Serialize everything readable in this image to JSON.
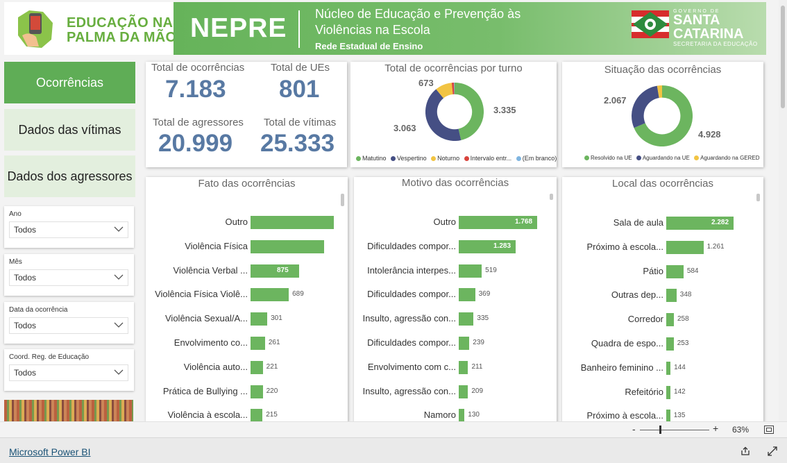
{
  "header": {
    "brand_line1": "EDUCAÇÃO NA",
    "brand_line2": "PALMA DA MÃO",
    "program": "NEPRE",
    "title_line1": "Núcleo de Educação e Prevenção às",
    "title_line2": "Violências na Escola",
    "subtitle": "Rede Estadual de Ensino",
    "gov_line": "GOVERNO DE",
    "state_line1": "SANTA",
    "state_line2": "CATARINA",
    "secretaria": "SECRETARIA DA EDUCAÇÃO"
  },
  "nav": {
    "items": [
      {
        "label": "Ocorrências",
        "active": true
      },
      {
        "label": "Dados das vítimas",
        "active": false
      },
      {
        "label": "Dados dos agressores",
        "active": false
      }
    ]
  },
  "slicers": [
    {
      "label": "Ano",
      "value": "Todos"
    },
    {
      "label": "Mês",
      "value": "Todos"
    },
    {
      "label": "Data da ocorrência",
      "value": "Todos"
    },
    {
      "label": "Coord. Reg. de Educação",
      "value": "Todos"
    }
  ],
  "kpis": {
    "ocorrencias": {
      "label": "Total de ocorrências",
      "value": "7.183"
    },
    "ues": {
      "label": "Total de UEs",
      "value": "801"
    },
    "agressores": {
      "label": "Total de agressores",
      "value": "20.999"
    },
    "vitimas": {
      "label": "Total de vítimas",
      "value": "25.333"
    }
  },
  "colors": {
    "accent": "#5fad56",
    "bar": "#6cb55f",
    "kpi": "#5879a3",
    "navy": "#454f84",
    "yellow": "#f2c443",
    "red": "#d9443d",
    "light_blue": "#7fb5e0"
  },
  "turno": {
    "title": "Total de ocorrências por turno",
    "labels": {
      "matutino": "3.335",
      "vespertino": "3.063",
      "noturno": "673"
    },
    "legend": [
      "Matutino",
      "Vespertino",
      "Noturno",
      "Intervalo entr...",
      "(Em branco)"
    ]
  },
  "situacao": {
    "title": "Situação das ocorrências",
    "labels": {
      "resolvido": "4.928",
      "aguardando_ue": "2.067"
    },
    "legend": [
      "Resolvido na UE",
      "Aguardando na UE",
      "Aguardando na GERED"
    ]
  },
  "chart_data": [
    {
      "type": "pie",
      "title": "Total de ocorrências por turno",
      "categories": [
        "Matutino",
        "Vespertino",
        "Noturno",
        "Intervalo entr...",
        "(Em branco)"
      ],
      "values": [
        3335,
        3063,
        673,
        90,
        22
      ],
      "colors": [
        "#6cb55f",
        "#454f84",
        "#f2c443",
        "#d9443d",
        "#7fb5e0"
      ]
    },
    {
      "type": "pie",
      "title": "Situação das ocorrências",
      "categories": [
        "Resolvido na UE",
        "Aguardando na UE",
        "Aguardando na GERED"
      ],
      "values": [
        4928,
        2067,
        188
      ],
      "colors": [
        "#6cb55f",
        "#454f84",
        "#f2c443"
      ]
    },
    {
      "type": "bar",
      "title": "Fato das ocorrências",
      "categories": [
        "Outro",
        "Violência Física",
        "Violência Verbal ...",
        "Violência Física Violê...",
        "Violência Sexual/A...",
        "Envolvimento co...",
        "Violência auto...",
        "Prática de Bullying ...",
        "Violência à escola..."
      ],
      "values": [
        1500,
        1330,
        875,
        689,
        301,
        261,
        221,
        220,
        215
      ],
      "labels": [
        "",
        "",
        "875",
        "689",
        "301",
        "261",
        "221",
        "220",
        "215"
      ]
    },
    {
      "type": "bar",
      "title": "Motivo das ocorrências",
      "categories": [
        "Outro",
        "Dificuldades compor...",
        "Intolerância interpes...",
        "Dificuldades compor...",
        "Insulto, agressão con...",
        "Dificuldades compor...",
        "Envolvimento com c...",
        "Insulto, agressão con...",
        "Namoro"
      ],
      "values": [
        1768,
        1283,
        519,
        369,
        335,
        239,
        211,
        209,
        130
      ],
      "labels": [
        "1.768",
        "1.283",
        "519",
        "369",
        "335",
        "239",
        "211",
        "209",
        "130"
      ]
    },
    {
      "type": "bar",
      "title": "Local das ocorrências",
      "categories": [
        "Sala de aula",
        "Próximo à escola...",
        "Pátio",
        "Outras dep...",
        "Corredor",
        "Quadra de espo...",
        "Banheiro feminino ...",
        "Refeitório",
        "Próximo à escola..."
      ],
      "values": [
        2282,
        1261,
        584,
        348,
        258,
        253,
        144,
        142,
        135
      ],
      "labels": [
        "2.282",
        "1.261",
        "584",
        "348",
        "258",
        "253",
        "144",
        "142",
        "135"
      ]
    }
  ],
  "zoom": {
    "minus": "-",
    "plus": "+",
    "level": "63%"
  },
  "footer": {
    "link": "Microsoft Power BI"
  }
}
